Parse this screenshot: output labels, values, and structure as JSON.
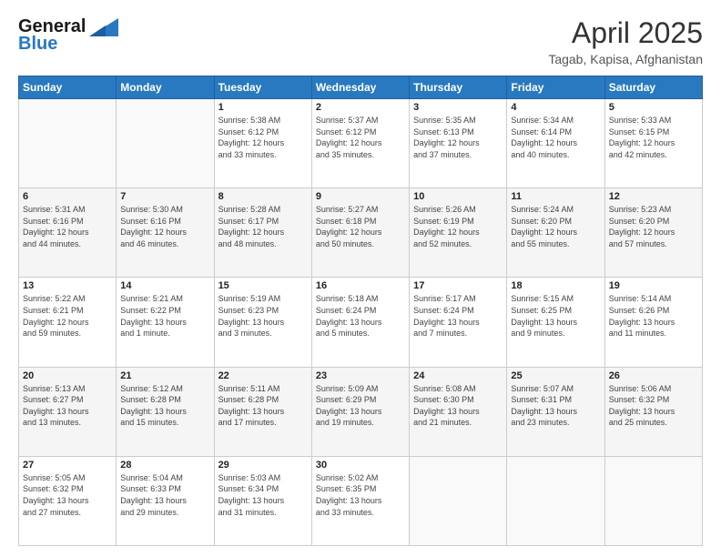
{
  "header": {
    "logo_general": "General",
    "logo_blue": "Blue",
    "month_title": "April 2025",
    "location": "Tagab, Kapisa, Afghanistan"
  },
  "days_of_week": [
    "Sunday",
    "Monday",
    "Tuesday",
    "Wednesday",
    "Thursday",
    "Friday",
    "Saturday"
  ],
  "weeks": [
    [
      {
        "num": "",
        "info": ""
      },
      {
        "num": "",
        "info": ""
      },
      {
        "num": "1",
        "info": "Sunrise: 5:38 AM\nSunset: 6:12 PM\nDaylight: 12 hours\nand 33 minutes."
      },
      {
        "num": "2",
        "info": "Sunrise: 5:37 AM\nSunset: 6:12 PM\nDaylight: 12 hours\nand 35 minutes."
      },
      {
        "num": "3",
        "info": "Sunrise: 5:35 AM\nSunset: 6:13 PM\nDaylight: 12 hours\nand 37 minutes."
      },
      {
        "num": "4",
        "info": "Sunrise: 5:34 AM\nSunset: 6:14 PM\nDaylight: 12 hours\nand 40 minutes."
      },
      {
        "num": "5",
        "info": "Sunrise: 5:33 AM\nSunset: 6:15 PM\nDaylight: 12 hours\nand 42 minutes."
      }
    ],
    [
      {
        "num": "6",
        "info": "Sunrise: 5:31 AM\nSunset: 6:16 PM\nDaylight: 12 hours\nand 44 minutes."
      },
      {
        "num": "7",
        "info": "Sunrise: 5:30 AM\nSunset: 6:16 PM\nDaylight: 12 hours\nand 46 minutes."
      },
      {
        "num": "8",
        "info": "Sunrise: 5:28 AM\nSunset: 6:17 PM\nDaylight: 12 hours\nand 48 minutes."
      },
      {
        "num": "9",
        "info": "Sunrise: 5:27 AM\nSunset: 6:18 PM\nDaylight: 12 hours\nand 50 minutes."
      },
      {
        "num": "10",
        "info": "Sunrise: 5:26 AM\nSunset: 6:19 PM\nDaylight: 12 hours\nand 52 minutes."
      },
      {
        "num": "11",
        "info": "Sunrise: 5:24 AM\nSunset: 6:20 PM\nDaylight: 12 hours\nand 55 minutes."
      },
      {
        "num": "12",
        "info": "Sunrise: 5:23 AM\nSunset: 6:20 PM\nDaylight: 12 hours\nand 57 minutes."
      }
    ],
    [
      {
        "num": "13",
        "info": "Sunrise: 5:22 AM\nSunset: 6:21 PM\nDaylight: 12 hours\nand 59 minutes."
      },
      {
        "num": "14",
        "info": "Sunrise: 5:21 AM\nSunset: 6:22 PM\nDaylight: 13 hours\nand 1 minute."
      },
      {
        "num": "15",
        "info": "Sunrise: 5:19 AM\nSunset: 6:23 PM\nDaylight: 13 hours\nand 3 minutes."
      },
      {
        "num": "16",
        "info": "Sunrise: 5:18 AM\nSunset: 6:24 PM\nDaylight: 13 hours\nand 5 minutes."
      },
      {
        "num": "17",
        "info": "Sunrise: 5:17 AM\nSunset: 6:24 PM\nDaylight: 13 hours\nand 7 minutes."
      },
      {
        "num": "18",
        "info": "Sunrise: 5:15 AM\nSunset: 6:25 PM\nDaylight: 13 hours\nand 9 minutes."
      },
      {
        "num": "19",
        "info": "Sunrise: 5:14 AM\nSunset: 6:26 PM\nDaylight: 13 hours\nand 11 minutes."
      }
    ],
    [
      {
        "num": "20",
        "info": "Sunrise: 5:13 AM\nSunset: 6:27 PM\nDaylight: 13 hours\nand 13 minutes."
      },
      {
        "num": "21",
        "info": "Sunrise: 5:12 AM\nSunset: 6:28 PM\nDaylight: 13 hours\nand 15 minutes."
      },
      {
        "num": "22",
        "info": "Sunrise: 5:11 AM\nSunset: 6:28 PM\nDaylight: 13 hours\nand 17 minutes."
      },
      {
        "num": "23",
        "info": "Sunrise: 5:09 AM\nSunset: 6:29 PM\nDaylight: 13 hours\nand 19 minutes."
      },
      {
        "num": "24",
        "info": "Sunrise: 5:08 AM\nSunset: 6:30 PM\nDaylight: 13 hours\nand 21 minutes."
      },
      {
        "num": "25",
        "info": "Sunrise: 5:07 AM\nSunset: 6:31 PM\nDaylight: 13 hours\nand 23 minutes."
      },
      {
        "num": "26",
        "info": "Sunrise: 5:06 AM\nSunset: 6:32 PM\nDaylight: 13 hours\nand 25 minutes."
      }
    ],
    [
      {
        "num": "27",
        "info": "Sunrise: 5:05 AM\nSunset: 6:32 PM\nDaylight: 13 hours\nand 27 minutes."
      },
      {
        "num": "28",
        "info": "Sunrise: 5:04 AM\nSunset: 6:33 PM\nDaylight: 13 hours\nand 29 minutes."
      },
      {
        "num": "29",
        "info": "Sunrise: 5:03 AM\nSunset: 6:34 PM\nDaylight: 13 hours\nand 31 minutes."
      },
      {
        "num": "30",
        "info": "Sunrise: 5:02 AM\nSunset: 6:35 PM\nDaylight: 13 hours\nand 33 minutes."
      },
      {
        "num": "",
        "info": ""
      },
      {
        "num": "",
        "info": ""
      },
      {
        "num": "",
        "info": ""
      }
    ]
  ]
}
